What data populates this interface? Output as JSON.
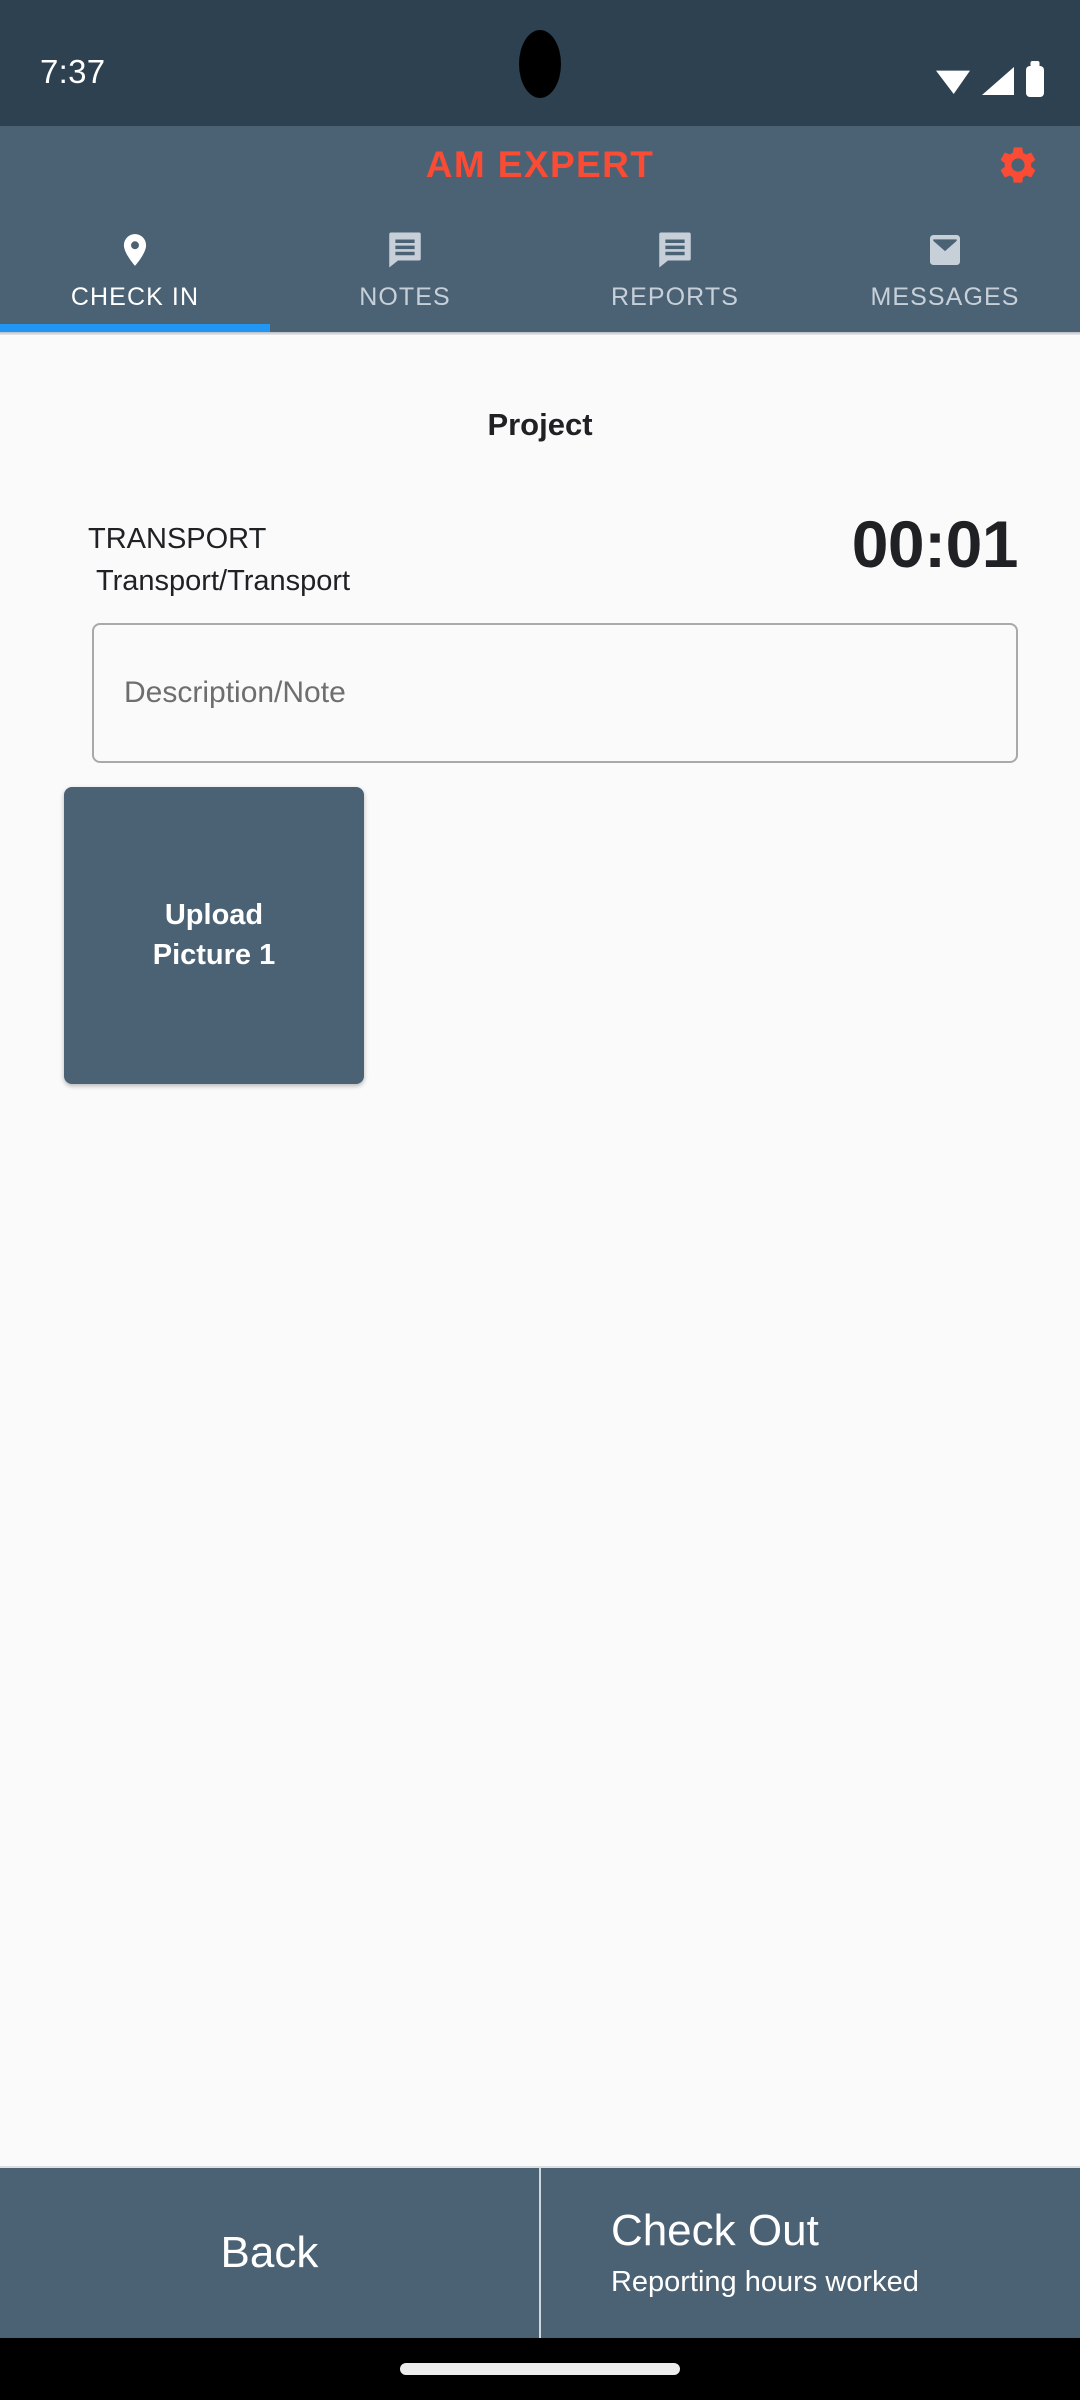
{
  "status_bar": {
    "time": "7:37",
    "icons": [
      "wifi-icon",
      "cellular-signal-icon",
      "battery-icon"
    ]
  },
  "app_bar": {
    "title": "AM EXPERT",
    "title_color": "#fa4b34",
    "background_color": "#4b6275",
    "settings_icon": "gear-icon"
  },
  "tabs": {
    "active_index": 0,
    "indicator_color": "#2196f3",
    "items": [
      {
        "label": "CHECK IN",
        "icon": "location-pin-icon"
      },
      {
        "label": "NOTES",
        "icon": "note-bubble-icon"
      },
      {
        "label": "REPORTS",
        "icon": "report-bubble-icon"
      },
      {
        "label": "MESSAGES",
        "icon": "envelope-icon"
      }
    ]
  },
  "main": {
    "page_title": "Project",
    "task": {
      "code": "TRANSPORT",
      "path": "Transport/Transport"
    },
    "timer": "00:01",
    "note": {
      "value": "",
      "placeholder": "Description/Note"
    },
    "upload": {
      "label": "Upload\nPicture 1",
      "background_color": "#4b6275"
    }
  },
  "bottom_bar": {
    "back": {
      "label": "Back"
    },
    "check_out": {
      "label": "Check Out",
      "subtitle": "Reporting hours worked"
    }
  },
  "nav_bar": {
    "handle": "gesture-home-handle"
  }
}
